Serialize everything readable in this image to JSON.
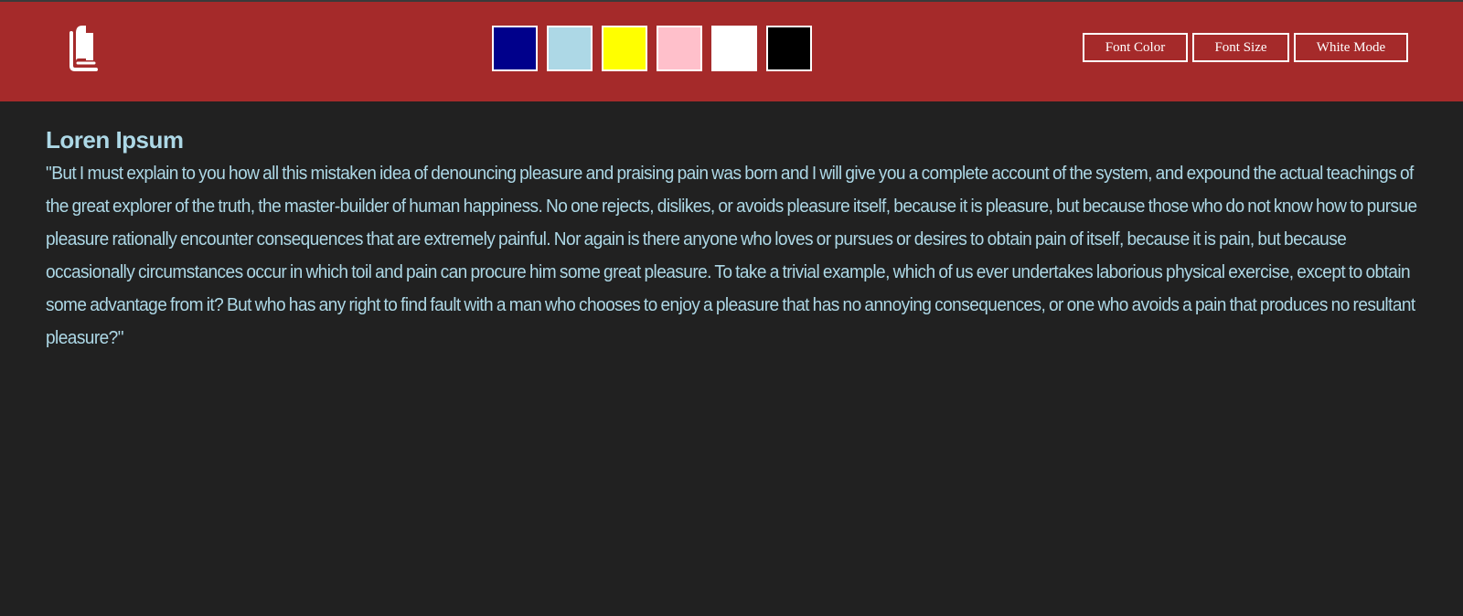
{
  "header": {
    "logo_icon": "book-icon",
    "swatches": [
      {
        "name": "navy",
        "color": "#00008b"
      },
      {
        "name": "lightblue",
        "color": "#add8e6"
      },
      {
        "name": "yellow",
        "color": "#ffff00"
      },
      {
        "name": "pink",
        "color": "#ffc0cb"
      },
      {
        "name": "white",
        "color": "#ffffff"
      },
      {
        "name": "black",
        "color": "#000000"
      }
    ],
    "buttons": {
      "font_color": "Font Color",
      "font_size": "Font Size",
      "white_mode": "White Mode"
    }
  },
  "content": {
    "title": "Loren Ipsum",
    "body": "\"But I must explain to you how all this mistaken idea of denouncing pleasure and praising pain was born and I will give you a complete account of the system, and expound the actual teachings of the great explorer of the truth, the master-builder of human happiness. No one rejects, dislikes, or avoids pleasure itself, because it is pleasure, but because those who do not know how to pursue pleasure rationally encounter consequences that are extremely painful. Nor again is there anyone who loves or pursues or desires to obtain pain of itself, because it is pain, but because occasionally circumstances occur in which toil and pain can procure him some great pleasure. To take a trivial example, which of us ever undertakes laborious physical exercise, except to obtain some advantage from it? But who has any right to find fault with a man who chooses to enjoy a pleasure that has no annoying consequences, or one who avoids a pain that produces no resultant pleasure?\""
  },
  "colors": {
    "header_bg": "#a52a2a",
    "page_bg": "#212121",
    "text": "#add8e6",
    "border": "#ffffff"
  }
}
